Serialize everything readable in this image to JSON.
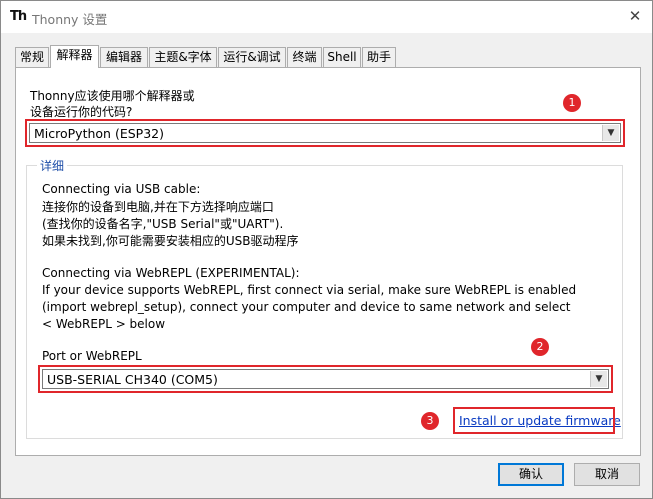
{
  "window": {
    "title": "Thonny 设置",
    "app_icon_text": "Th"
  },
  "tabs": [
    {
      "label": "常规"
    },
    {
      "label": "解释器"
    },
    {
      "label": "编辑器"
    },
    {
      "label": "主题&字体"
    },
    {
      "label": "运行&调试"
    },
    {
      "label": "终端"
    },
    {
      "label": "Shell"
    },
    {
      "label": "助手"
    }
  ],
  "interpreter": {
    "question_line1": "Thonny应该使用哪个解释器或",
    "question_line2": "设备运行你的代码?",
    "selected": "MicroPython (ESP32)"
  },
  "details": {
    "group_label": "详细",
    "usb_heading": "Connecting via USB cable:",
    "usb_line1": "连接你的设备到电脑,并在下方选择响应端口",
    "usb_line2": "(查找你的设备名字,\"USB Serial\"或\"UART\").",
    "usb_line3": "如果未找到,你可能需要安装相应的USB驱动程序",
    "webrepl_heading": "Connecting via WebREPL (EXPERIMENTAL):",
    "webrepl_line1": "If your device supports WebREPL, first connect via serial, make sure WebREPL is enabled",
    "webrepl_line2": "(import webrepl_setup), connect your computer and device to same network and select",
    "webrepl_line3": "< WebREPL > below",
    "port_label": "Port or WebREPL",
    "port_selected": "USB-SERIAL CH340 (COM5)",
    "firmware_link": "Install or update firmware"
  },
  "annotations": {
    "badge1": "1",
    "badge2": "2",
    "badge3": "3",
    "color": "#e0262b"
  },
  "buttons": {
    "ok": "确认",
    "cancel": "取消"
  },
  "icons": {
    "close": "close-icon",
    "dropdown": "chevron-down-icon"
  }
}
